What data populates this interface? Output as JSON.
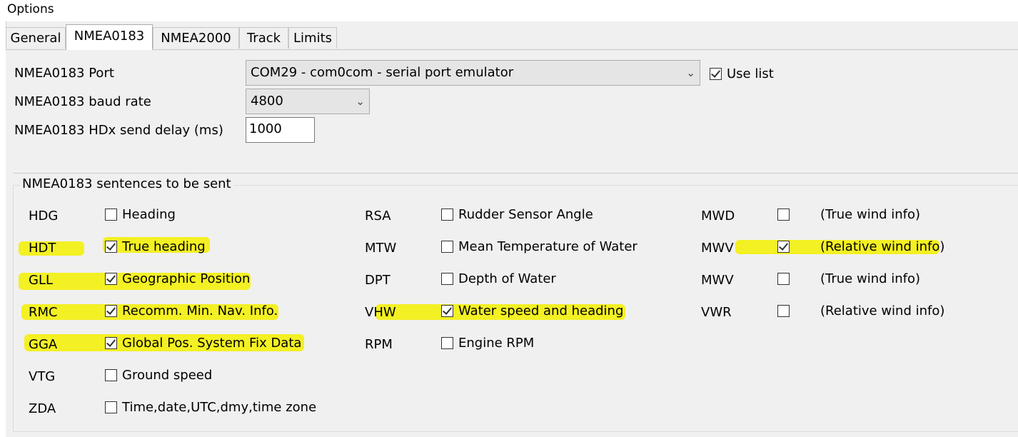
{
  "window": {
    "title": "Options"
  },
  "tabs": [
    {
      "label": "General"
    },
    {
      "label": "NMEA0183"
    },
    {
      "label": "NMEA2000"
    },
    {
      "label": "Track"
    },
    {
      "label": "Limits"
    }
  ],
  "port": {
    "label": "NMEA0183 Port",
    "value": "COM29 - com0com - serial port emulator",
    "use_list_label": "Use list",
    "use_list_checked": true
  },
  "baud": {
    "label": "NMEA0183 baud rate",
    "value": "4800"
  },
  "delay": {
    "label": "NMEA0183 HDx send delay (ms)",
    "value": "1000"
  },
  "sentences": {
    "group_title": "NMEA0183 sentences to be sent",
    "col1": [
      {
        "code": "HDG",
        "desc": "Heading",
        "checked": false
      },
      {
        "code": "HDT",
        "desc": "True heading",
        "checked": true
      },
      {
        "code": "GLL",
        "desc": "Geographic Position",
        "checked": true
      },
      {
        "code": "RMC",
        "desc": "Recomm. Min. Nav. Info.",
        "checked": true
      },
      {
        "code": "GGA",
        "desc": "Global Pos. System Fix Data",
        "checked": true
      },
      {
        "code": "VTG",
        "desc": "Ground speed",
        "checked": false
      },
      {
        "code": "ZDA",
        "desc": "Time,date,UTC,dmy,time zone",
        "checked": false
      }
    ],
    "col2": [
      {
        "code": "RSA",
        "desc": "Rudder Sensor Angle",
        "checked": false
      },
      {
        "code": "MTW",
        "desc": "Mean Temperature of Water",
        "checked": false
      },
      {
        "code": "DPT",
        "desc": "Depth of Water",
        "checked": false
      },
      {
        "code": "VHW",
        "desc": "Water speed and heading",
        "checked": true
      },
      {
        "code": "RPM",
        "desc": "Engine RPM",
        "checked": false
      }
    ],
    "col3": [
      {
        "code": "MWD",
        "desc": "(True wind info)",
        "checked": false
      },
      {
        "code": "MWV",
        "desc": "(Relative wind info)",
        "checked": true
      },
      {
        "code": "MWV",
        "desc": "(True wind info)",
        "checked": false
      },
      {
        "code": "VWR",
        "desc": "(Relative wind info)",
        "checked": false
      }
    ]
  },
  "colors": {
    "highlight": "#f3f000",
    "window": "#f0f0f0",
    "combo": "#e5e5e5"
  }
}
